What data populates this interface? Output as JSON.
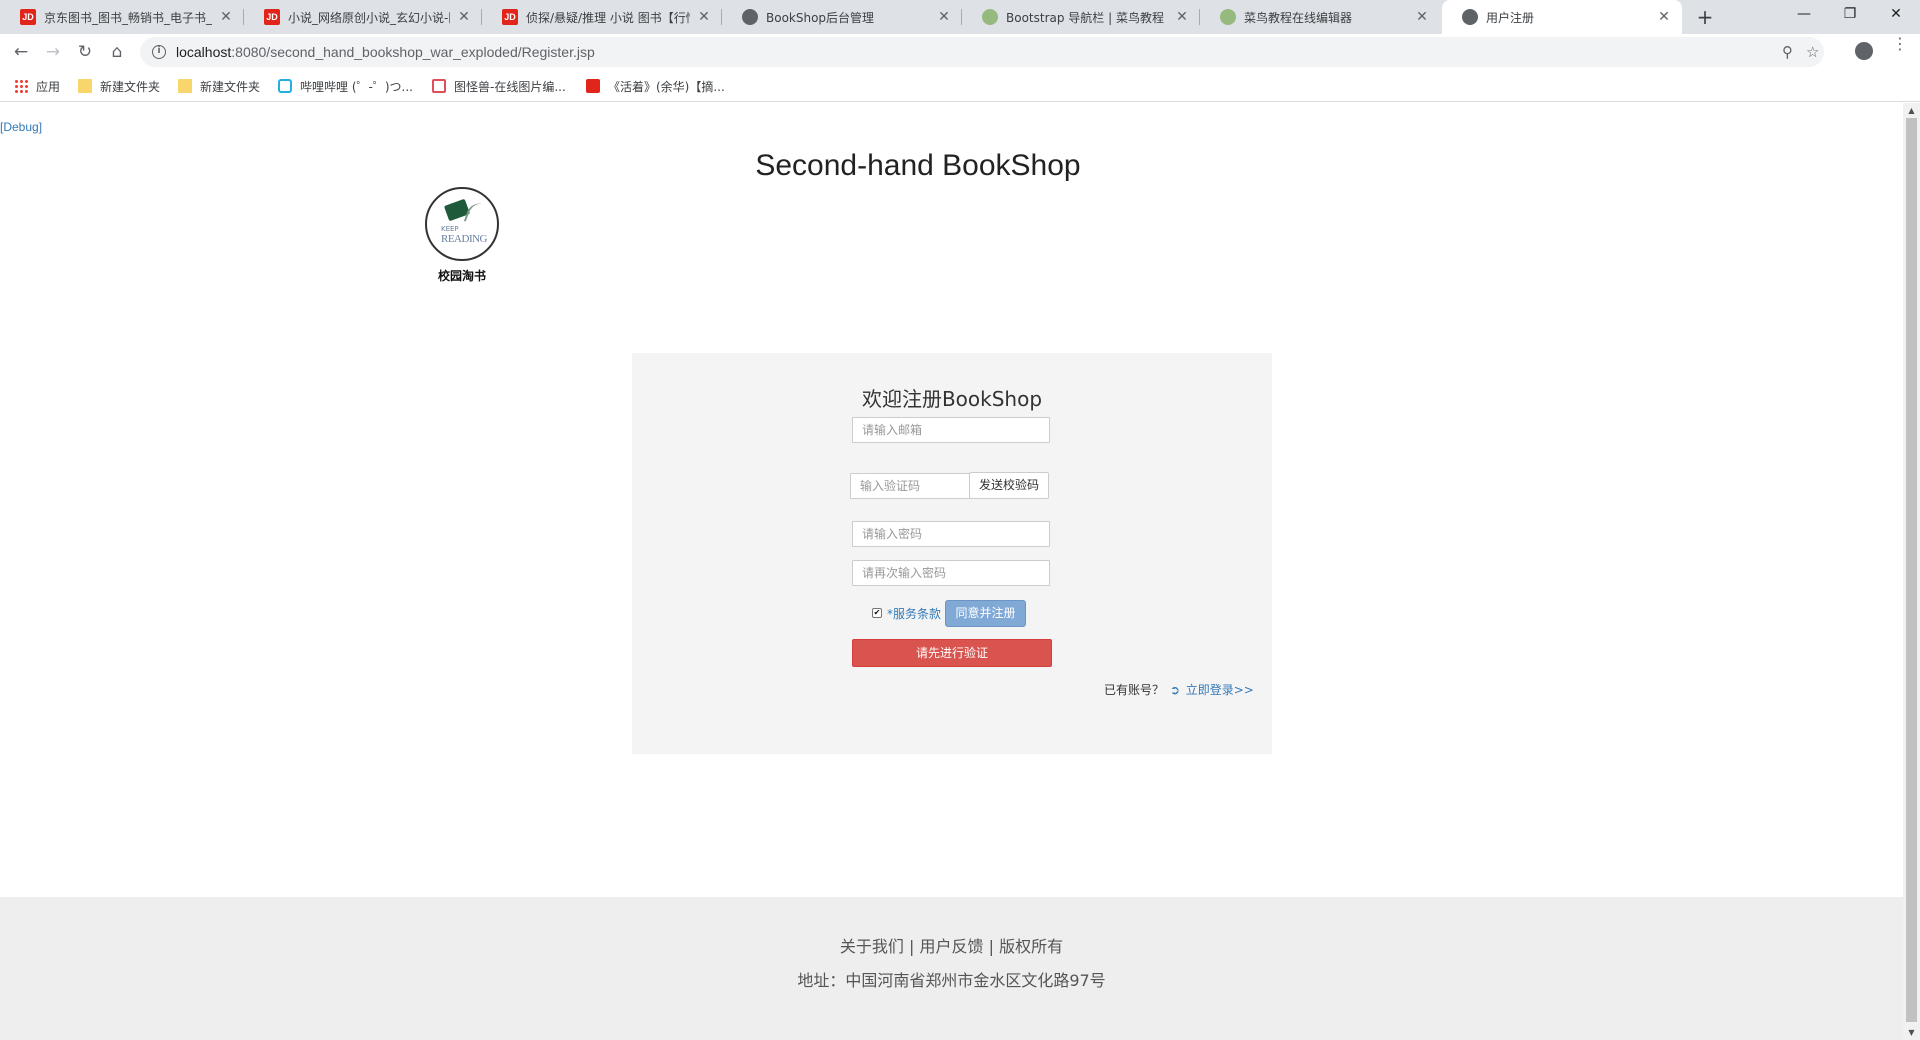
{
  "browser": {
    "tabs": [
      {
        "title": "京东图书_图书_畅销书_电子书_新",
        "favicon": "jd-icon"
      },
      {
        "title": "小说_网络原创小说_玄幻小说-图",
        "favicon": "jd-icon"
      },
      {
        "title": "侦探/悬疑/推理 小说 图书【行情",
        "favicon": "jd-icon"
      },
      {
        "title": "BookShop后台管理",
        "favicon": "globe-icon"
      },
      {
        "title": "Bootstrap 导航栏 | 菜鸟教程",
        "favicon": "runoob-icon"
      },
      {
        "title": "菜鸟教程在线编辑器",
        "favicon": "runoob-icon"
      },
      {
        "title": "用户注册",
        "favicon": "globe-icon"
      }
    ],
    "tab_close_glyph": "✕",
    "new_tab_glyph": "+",
    "jd_favicon_text": "JD",
    "url_host": "localhost",
    "url_rest": ":8080/second_hand_bookshop_war_exploded/Register.jsp",
    "bookmarks": [
      {
        "label": "应用",
        "icon": "apps-icon"
      },
      {
        "label": "新建文件夹",
        "icon": "folder-icon"
      },
      {
        "label": "新建文件夹",
        "icon": "folder-icon"
      },
      {
        "label": "哔哩哔哩 (゜-゜)つ...",
        "icon": "bilibili-icon"
      },
      {
        "label": "图怪兽-在线图片编...",
        "icon": "tuguaishou-icon"
      },
      {
        "label": "《活着》(余华)【摘...",
        "icon": "jd-icon"
      }
    ]
  },
  "page": {
    "debug_link": "[Debug]",
    "site_title": "Second-hand BookShop",
    "logo": {
      "keep": "KEEP",
      "reading": "READING",
      "caption": "校园淘书"
    },
    "register": {
      "heading": "欢迎注册BookShop",
      "email_placeholder": "请输入邮箱",
      "code_placeholder": "输入验证码",
      "send_code_label": "发送校验码",
      "password_placeholder": "请输入密码",
      "password_confirm_placeholder": "请再次输入密码",
      "terms_checked": true,
      "terms_label": "*服务条款",
      "agree_label": "同意并注册",
      "verify_label": "请先进行验证",
      "have_account": "已有账号？",
      "login_link": "立即登录>>"
    },
    "footer": {
      "about": "关于我们",
      "feedback": "用户反馈",
      "copyright": "版权所有",
      "separator": "|",
      "address": "地址：中国河南省郑州市金水区文化路97号"
    }
  },
  "colors": {
    "link": "#337ab7",
    "danger": "#d9534f",
    "agree_button": "#81a9d6",
    "panel_bg": "#f4f4f4",
    "footer_bg": "#eeeeee"
  }
}
